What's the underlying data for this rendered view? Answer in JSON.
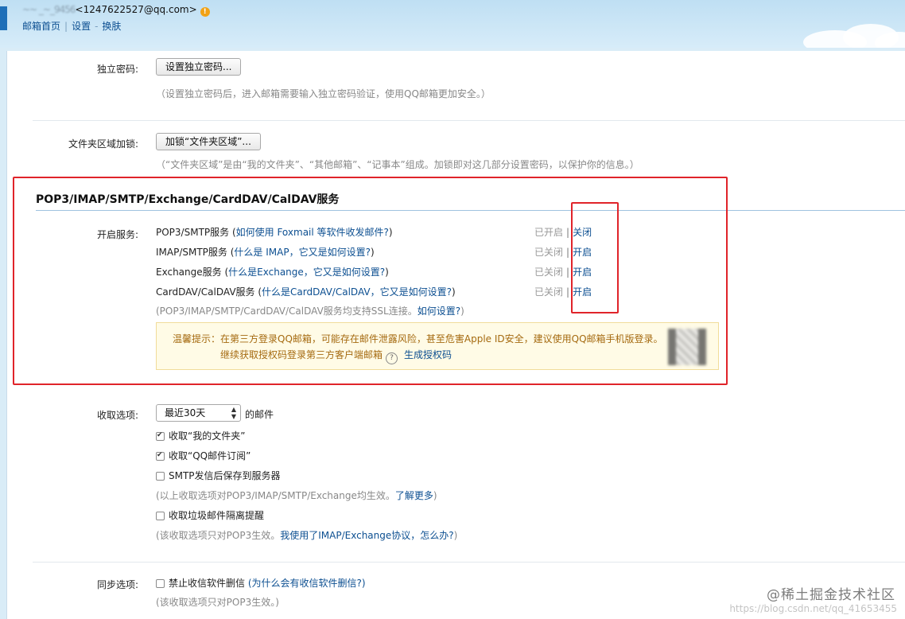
{
  "header": {
    "account_prefix": "~~ _~_9456",
    "account_email": "<1247622527@qq.com>",
    "links": [
      "邮箱首页",
      "设置",
      "换肤"
    ]
  },
  "rows": {
    "independent_password": {
      "label": "独立密码:",
      "button": "设置独立密码...",
      "note": "（设置独立密码后，进入邮箱需要输入独立密码验证，使用QQ邮箱更加安全。）"
    },
    "folder_lock": {
      "label": "文件夹区域加锁:",
      "button": "加锁“文件夹区域”...",
      "note": "（“文件夹区域”是由“我的文件夹”、“其他邮箱”、“记事本”组成。加锁即对这几部分设置密码，以保护你的信息。）"
    }
  },
  "services": {
    "title": "POP3/IMAP/SMTP/Exchange/CardDAV/CalDAV服务",
    "label": "开启服务:",
    "items": [
      {
        "name": "POP3/SMTP服务",
        "help": "如何使用 Foxmail 等软件收发邮件?",
        "status": "已开启",
        "action": "关闭"
      },
      {
        "name": "IMAP/SMTP服务",
        "help": "什么是 IMAP，它又是如何设置?",
        "status": "已关闭",
        "action": "开启"
      },
      {
        "name": "Exchange服务",
        "help": "什么是Exchange，它又是如何设置?",
        "status": "已关闭",
        "action": "开启"
      },
      {
        "name": "CardDAV/CalDAV服务",
        "help": "什么是CardDAV/CalDAV，它又是如何设置?",
        "status": "已关闭",
        "action": "开启"
      }
    ],
    "ssl_note": "(POP3/IMAP/SMTP/CardDAV/CalDAV服务均支持SSL连接。",
    "ssl_link": "如何设置?",
    "ssl_end": ")",
    "tip": {
      "line1": "温馨提示：在第三方登录QQ邮箱，可能存在邮件泄露风险，甚至危害Apple ID安全，建议使用QQ邮箱手机版登录。",
      "line2": "继续获取授权码登录第三方客户端邮箱",
      "help_icon": "?",
      "link": "生成授权码"
    }
  },
  "receive": {
    "label": "收取选项:",
    "select_value": "最近30天",
    "after_select": "的邮件",
    "options": [
      {
        "text": "收取“我的文件夹”",
        "checked": true
      },
      {
        "text": "收取“QQ邮件订阅”",
        "checked": true
      },
      {
        "text": "SMTP发信后保存到服务器",
        "checked": false
      }
    ],
    "note1": "(以上收取选项对POP3/IMAP/SMTP/Exchange均生效。",
    "note1_link": "了解更多",
    "note1_end": ")",
    "junk_option": {
      "text": "收取垃圾邮件隔离提醒",
      "checked": false
    },
    "note2": "(该收取选项只对POP3生效。",
    "note2_link": "我使用了IMAP/Exchange协议，怎么办?",
    "note2_end": ")"
  },
  "sync": {
    "label": "同步选项:",
    "option": {
      "text": "禁止收信软件删信",
      "checked": false
    },
    "help": "(为什么会有收信软件删信?)",
    "note": "(该收取选项只对POP3生效。)"
  },
  "watermark": {
    "main": "@稀土掘金技术社区",
    "sub": "https://blog.csdn.net/qq_41653455"
  },
  "colors": {
    "link": "#0c4f91",
    "highlight_box": "#e0242a",
    "tip_bg": "#fffbe6",
    "tip_text": "#a56a10"
  }
}
